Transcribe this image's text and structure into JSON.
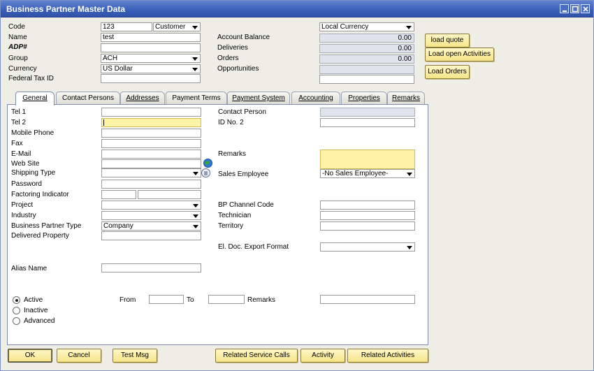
{
  "window": {
    "title": "Business Partner Master Data"
  },
  "header": {
    "code_label": "Code",
    "code_value": "123",
    "code_type": "Customer",
    "name_label": "Name",
    "name_value": "test",
    "adp_label": "ADP#",
    "adp_value": "",
    "group_label": "Group",
    "group_value": "ACH",
    "currency_label": "Currency",
    "currency_value": "US Dollar",
    "tax_label": "Federal Tax ID",
    "tax_value": "",
    "currency_mode": "Local Currency",
    "balance_label": "Account Balance",
    "balance_value": "0.00",
    "deliveries_label": "Deliveries",
    "deliveries_value": "0.00",
    "orders_label": "Orders",
    "orders_value": "0.00",
    "opportunities_label": "Opportunities",
    "opportunities_value": ""
  },
  "side_buttons": {
    "load_quote": "load quote",
    "load_open_activities": "Load open Activities",
    "load_orders": "Load Orders"
  },
  "tabs": [
    {
      "label": "General",
      "active": true
    },
    {
      "label": "Contact Persons"
    },
    {
      "label": "Addresses"
    },
    {
      "label": "Payment Terms"
    },
    {
      "label": "Payment System"
    },
    {
      "label": "Accounting"
    },
    {
      "label": "Properties"
    },
    {
      "label": "Remarks"
    }
  ],
  "general": {
    "tel1": "Tel 1",
    "tel2": "Tel 2",
    "mobile": "Mobile Phone",
    "fax": "Fax",
    "email": "E-Mail",
    "website": "Web Site",
    "shipping": "Shipping Type",
    "password": "Password",
    "factoring": "Factoring Indicator",
    "project": "Project",
    "industry": "Industry",
    "bp_type": "Business Partner Type",
    "bp_type_value": "Company",
    "delivered": "Delivered Property",
    "alias": "Alias Name",
    "contact_person": "Contact Person",
    "id_no2": "ID No. 2",
    "remarks": "Remarks",
    "sales_employee": "Sales Employee",
    "sales_employee_value": "-No Sales Employee-",
    "channel_code": "BP Channel Code",
    "technician": "Technician",
    "territory": "Territory",
    "eldoc": "El. Doc. Export Format",
    "active": "Active",
    "inactive": "Inactive",
    "advanced": "Advanced",
    "from": "From",
    "to": "To",
    "remarks2": "Remarks"
  },
  "footer": {
    "ok": "OK",
    "cancel": "Cancel",
    "test_msg": "Test Msg",
    "related_service_calls": "Related Service Calls",
    "activity": "Activity",
    "related_activities": "Related Activities"
  },
  "colors": {
    "titlebar": "#3a5fb8",
    "button": "#f6e487",
    "readonly": "#dfe3ec",
    "focus": "#fff3a6"
  }
}
